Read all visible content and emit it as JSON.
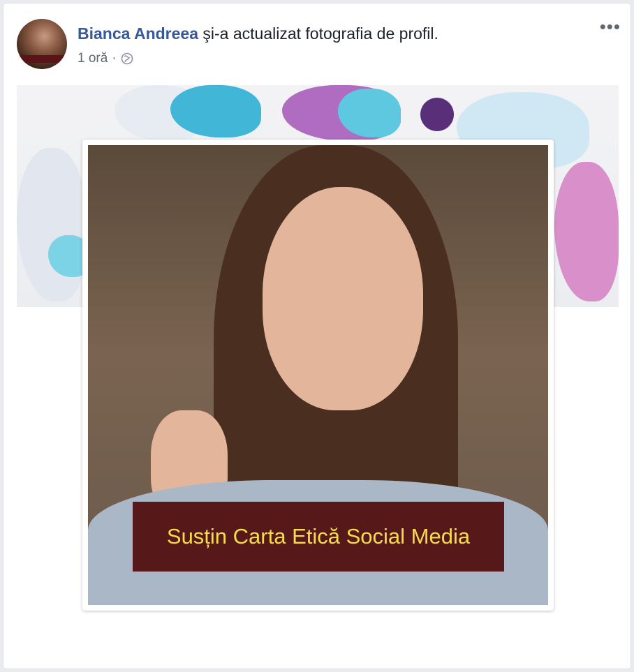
{
  "post": {
    "author_name": "Bianca Andreea",
    "action_text": "şi-a actualizat fotografia de profil.",
    "timestamp": "1 oră",
    "separator": "·",
    "privacy_icon": "globe-icon",
    "more_icon": "more-options-icon",
    "more_label": "•••"
  },
  "photo": {
    "overlay_text": "Susțin Carta Etică Social Media"
  },
  "colors": {
    "author_link": "#385898",
    "overlay_bg": "#561819",
    "overlay_text": "#f5dc4b"
  }
}
